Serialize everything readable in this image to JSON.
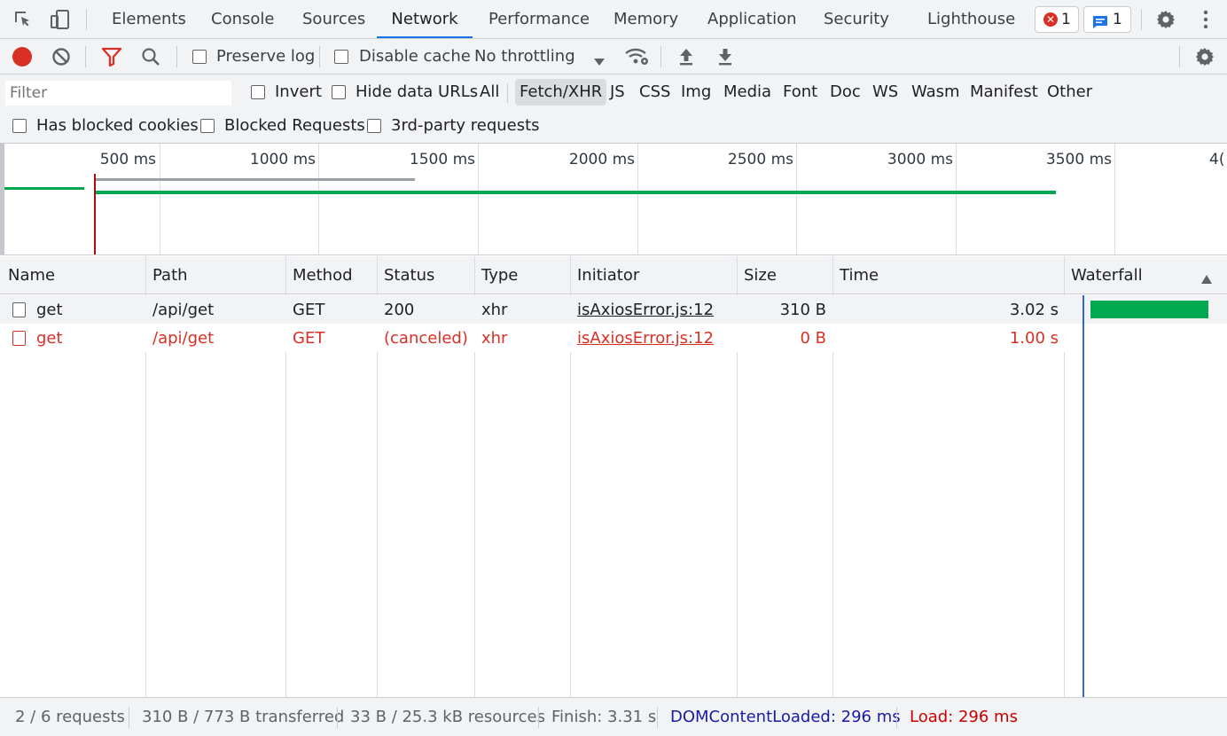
{
  "tabs": [
    {
      "label": "Elements"
    },
    {
      "label": "Console"
    },
    {
      "label": "Sources"
    },
    {
      "label": "Network",
      "active": true
    },
    {
      "label": "Performance"
    },
    {
      "label": "Memory"
    },
    {
      "label": "Application"
    },
    {
      "label": "Security"
    },
    {
      "label": "Lighthouse"
    }
  ],
  "badges": {
    "errors": "1",
    "messages": "1"
  },
  "toolbar": {
    "preserve_log": "Preserve log",
    "disable_cache": "Disable cache",
    "throttling": "No throttling"
  },
  "filter": {
    "placeholder": "Filter",
    "invert": "Invert",
    "hide_data_urls": "Hide data URLs",
    "types": [
      "All",
      "Fetch/XHR",
      "JS",
      "CSS",
      "Img",
      "Media",
      "Font",
      "Doc",
      "WS",
      "Wasm",
      "Manifest",
      "Other"
    ],
    "active_type": "Fetch/XHR",
    "has_blocked_cookies": "Has blocked cookies",
    "blocked_requests": "Blocked Requests",
    "third_party": "3rd-party requests"
  },
  "overview": {
    "ticks": [
      "500 ms",
      "1000 ms",
      "1500 ms",
      "2000 ms",
      "2500 ms",
      "3000 ms",
      "3500 ms",
      "4("
    ]
  },
  "table": {
    "headers": [
      "Name",
      "Path",
      "Method",
      "Status",
      "Type",
      "Initiator",
      "Size",
      "Time",
      "Waterfall"
    ],
    "rows": [
      {
        "name": "get",
        "path": "/api/get",
        "method": "GET",
        "status": "200",
        "type": "xhr",
        "initiator": "isAxiosError.js:12",
        "size": "310 B",
        "time": "3.02 s",
        "error": false
      },
      {
        "name": "get",
        "path": "/api/get",
        "method": "GET",
        "status": "(canceled)",
        "type": "xhr",
        "initiator": "isAxiosError.js:12",
        "size": "0 B",
        "time": "1.00 s",
        "error": true
      }
    ]
  },
  "status": {
    "requests": "2 / 6 requests",
    "transferred": "310 B / 773 B transferred",
    "resources": "33 B / 25.3 kB resources",
    "finish": "Finish: 3.31 s",
    "dcl": "DOMContentLoaded: 296 ms",
    "load": "Load: 296 ms"
  },
  "colors": {
    "accent": "#1a73e8",
    "error": "#d93025",
    "success": "#00a84f",
    "dcl": "#1a1aa6",
    "load": "#c80000"
  }
}
